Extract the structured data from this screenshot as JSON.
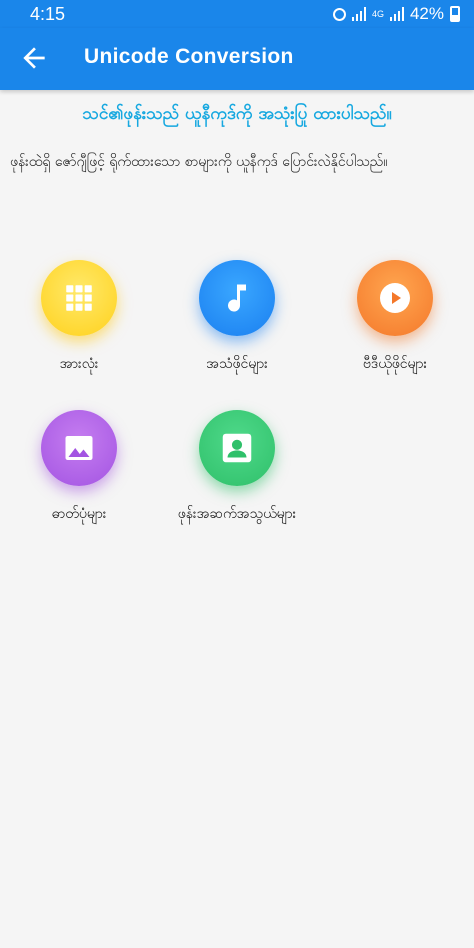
{
  "status_bar": {
    "time": "4:15",
    "network": "4G",
    "battery_percent": "42%"
  },
  "app_bar": {
    "title": "Unicode Conversion",
    "back_icon": "arrow-back-icon"
  },
  "headline": "သင်၏ဖုန်းသည် ယူနီကုဒ်ကို အသုံးပြု ထားပါသည်။",
  "description": "ဖုန်းထဲရှိ ဇော်ဂျီဖြင့် ရိုက်ထားသော စာများကို ယူနီကုဒ် ပြောင်းလဲနိုင်ပါသည်။",
  "categories": [
    {
      "label": "အားလုံး",
      "icon": "grid-icon",
      "color": "#ffd11c"
    },
    {
      "label": "အသံဖိုင်များ",
      "icon": "music-note-icon",
      "color": "#1a7ff0"
    },
    {
      "label": "ဗီဒီယိုဖိုင်များ",
      "icon": "play-icon",
      "color": "#f4782a"
    },
    {
      "label": "ဓာတ်ပုံများ",
      "icon": "image-icon",
      "color": "#a354e2"
    },
    {
      "label": "ဖုန်းအဆက်အသွယ်များ",
      "icon": "contact-icon",
      "color": "#2fc06a"
    }
  ],
  "colors": {
    "primary": "#1a86ea",
    "headline": "#16a8e0",
    "background": "#f5f5f5"
  }
}
